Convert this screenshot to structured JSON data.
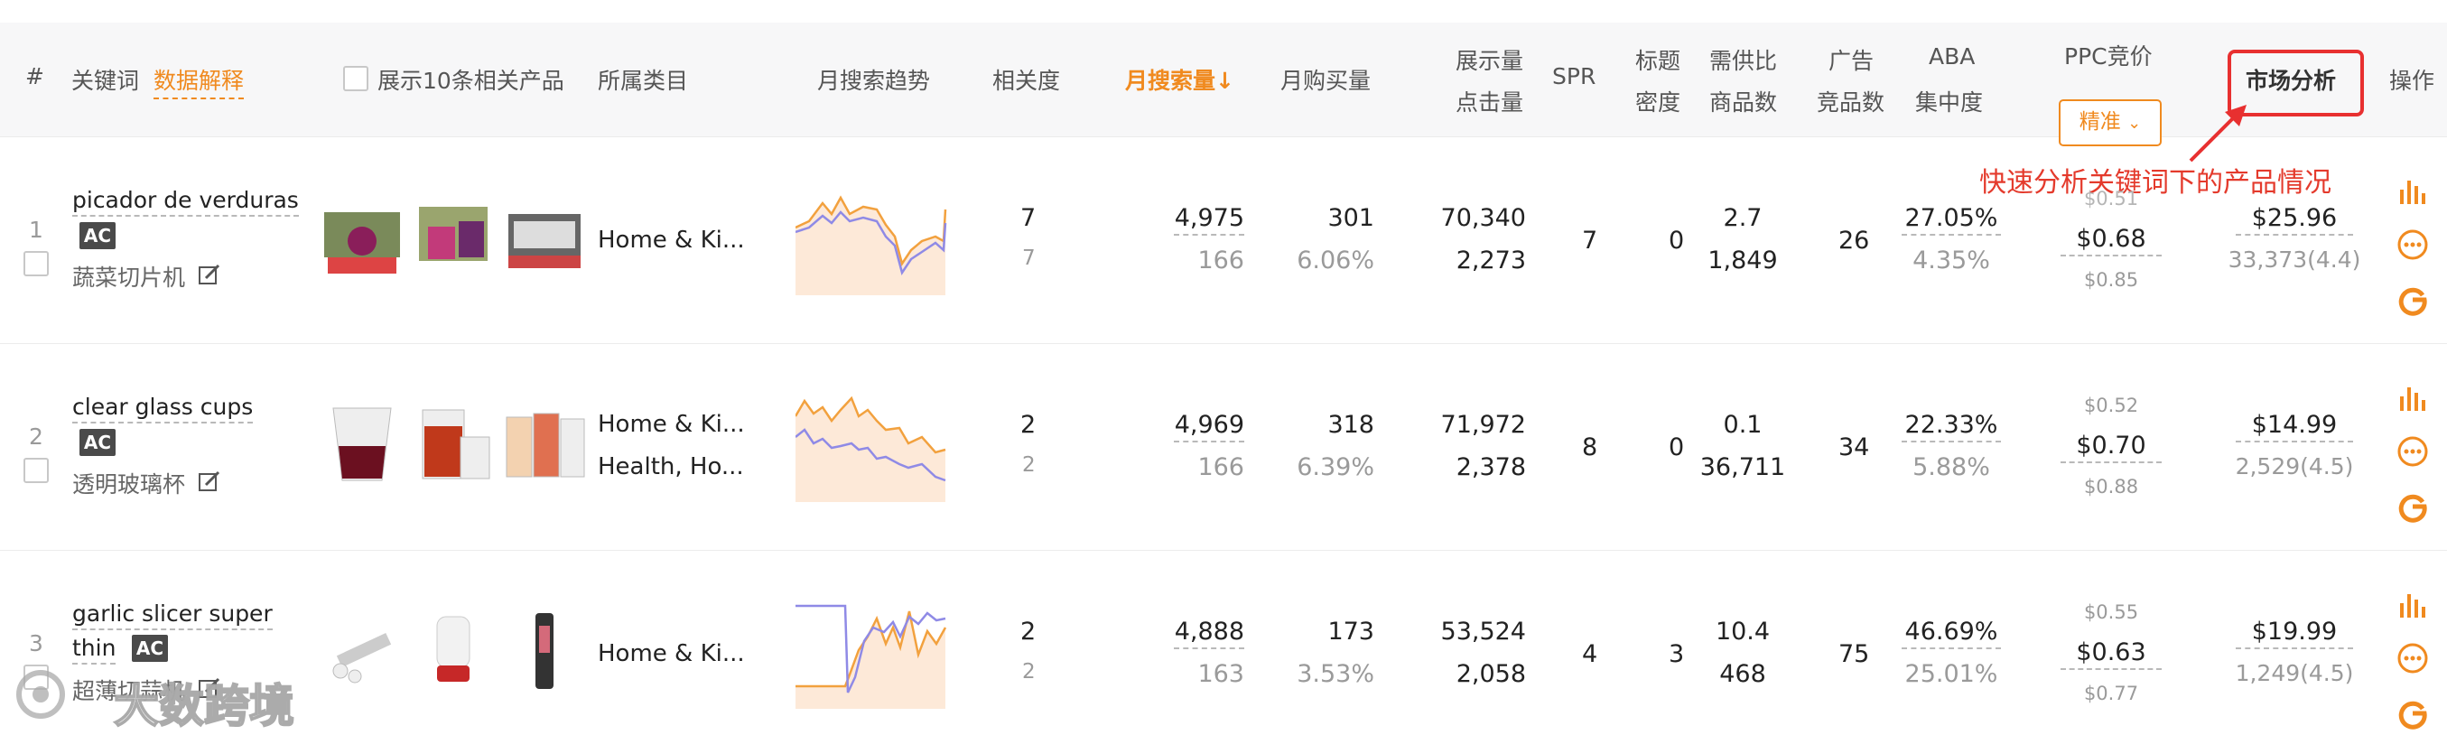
{
  "header": {
    "index": "#",
    "keyword": "关键词",
    "data_explain": "数据解释",
    "show_related": "展示10条相关产品",
    "category": "所属类目",
    "trend": "月搜索趋势",
    "relevance": "相关度",
    "monthly_search": "月搜索量↓",
    "monthly_purchase": "月购买量",
    "impressions_1": "展示量",
    "impressions_2": "点击量",
    "spr": "SPR",
    "title_density_1": "标题",
    "title_density_2": "密度",
    "supply_1": "需供比",
    "supply_2": "商品数",
    "ads_1": "广告",
    "ads_2": "竞品数",
    "aba_1": "ABA",
    "aba_2": "集中度",
    "ppc": "PPC竞价",
    "ppc_mode": "精准",
    "market": "市场分析",
    "ops": "操作"
  },
  "callout": "快速分析关键词下的产品情况",
  "watermark": "大数跨境",
  "colors": {
    "accent": "#f08a1f",
    "annotation": "#e83030",
    "trend_fill": "#fde9d8",
    "trend_orange": "#f2a13e",
    "trend_purple": "#8f8ae6"
  },
  "rows": [
    {
      "index": "1",
      "keyword_line1": "picador de verduras",
      "keyword_line2": "",
      "badge": "AC",
      "translation": "蔬菜切片机",
      "category_1": "Home & Ki...",
      "category_2": "",
      "relevance": "7",
      "relevance_sub": "7",
      "search": "4,975",
      "search_sub": "166",
      "purchase": "301",
      "purchase_rate": "6.06%",
      "impressions": "70,340",
      "clicks": "2,273",
      "spr": "7",
      "title_density": "0",
      "supply_ratio": "2.7",
      "products": "1,849",
      "ad_products": "26",
      "aba": "27.05%",
      "aba_sub": "4.35%",
      "ppc_low": "$0.51",
      "ppc_mid": "$0.68",
      "ppc_high": "$0.85",
      "price": "$25.96",
      "reviews": "33,373(4.4)"
    },
    {
      "index": "2",
      "keyword_line1": "clear glass cups",
      "keyword_line2": "",
      "badge": "AC",
      "translation": "透明玻璃杯",
      "category_1": "Home & Ki...",
      "category_2": "Health, Ho...",
      "relevance": "2",
      "relevance_sub": "2",
      "search": "4,969",
      "search_sub": "166",
      "purchase": "318",
      "purchase_rate": "6.39%",
      "impressions": "71,972",
      "clicks": "2,378",
      "spr": "8",
      "title_density": "0",
      "supply_ratio": "0.1",
      "products": "36,711",
      "ad_products": "34",
      "aba": "22.33%",
      "aba_sub": "5.88%",
      "ppc_low": "$0.52",
      "ppc_mid": "$0.70",
      "ppc_high": "$0.88",
      "price": "$14.99",
      "reviews": "2,529(4.5)"
    },
    {
      "index": "3",
      "keyword_line1": "garlic slicer super",
      "keyword_line2": "thin",
      "badge": "AC",
      "translation": "超薄切蒜机",
      "category_1": "Home & Ki...",
      "category_2": "",
      "relevance": "2",
      "relevance_sub": "2",
      "search": "4,888",
      "search_sub": "163",
      "purchase": "173",
      "purchase_rate": "3.53%",
      "impressions": "53,524",
      "clicks": "2,058",
      "spr": "4",
      "title_density": "3",
      "supply_ratio": "10.4",
      "products": "468",
      "ad_products": "75",
      "aba": "46.69%",
      "aba_sub": "25.01%",
      "ppc_low": "$0.55",
      "ppc_mid": "$0.63",
      "ppc_high": "$0.77",
      "price": "$19.99",
      "reviews": "1,249(4.5)"
    }
  ]
}
